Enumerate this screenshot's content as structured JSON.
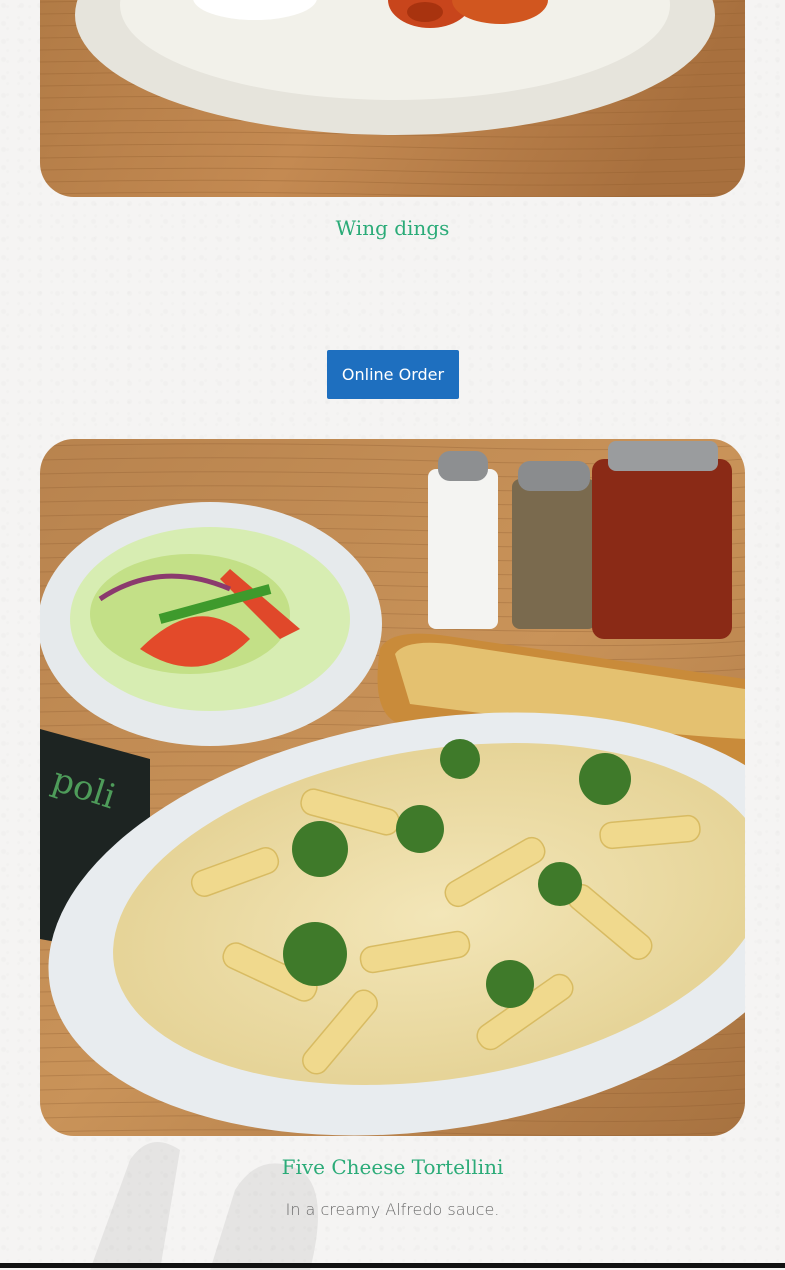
{
  "items": [
    {
      "title": "Wing dings",
      "description": ""
    },
    {
      "title": "Five Cheese Tortellini",
      "description": "In a creamy Alfredo sauce."
    }
  ],
  "order_button": {
    "label": "Online Order"
  },
  "colors": {
    "title": "#2bab78",
    "button": "#1e6fbf",
    "background": "#f5f4f3"
  }
}
